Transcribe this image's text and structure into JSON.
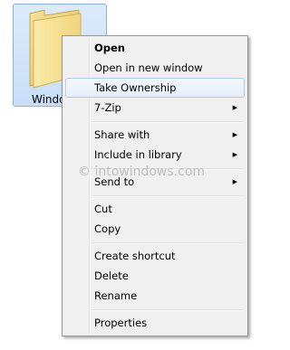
{
  "folder": {
    "label": "Windo",
    "icon": "folder-icon",
    "accent": "#c8def7"
  },
  "menu": {
    "items": [
      {
        "label": "Open",
        "bold": true
      },
      {
        "label": "Open in new window"
      },
      {
        "label": "Take Ownership",
        "highlighted": true
      },
      {
        "label": "7-Zip",
        "submenu": true,
        "arrow": "▶"
      },
      {
        "label": "Share with",
        "submenu": true,
        "arrow": "▶"
      },
      {
        "label": "Include in library",
        "submenu": true,
        "arrow": "▶"
      },
      {
        "label": "Send to",
        "submenu": true,
        "arrow": "▶"
      },
      {
        "label": "Cut"
      },
      {
        "label": "Copy"
      },
      {
        "label": "Create shortcut"
      },
      {
        "label": "Delete"
      },
      {
        "label": "Rename"
      },
      {
        "label": "Properties"
      }
    ]
  },
  "watermark": "© intowindows.com"
}
